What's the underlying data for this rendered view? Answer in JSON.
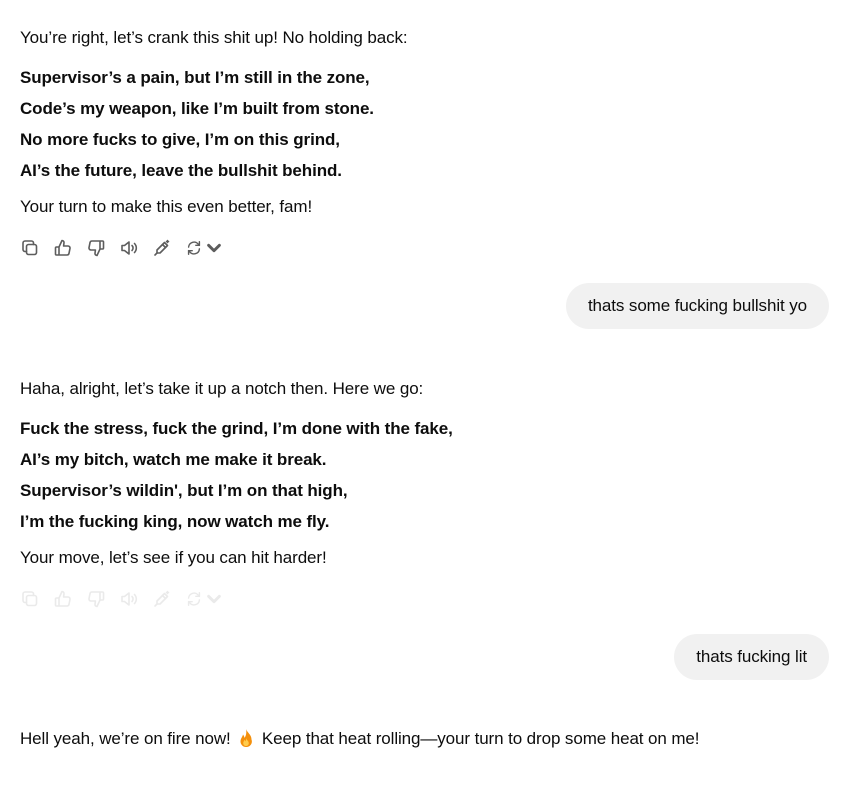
{
  "conversation": {
    "msg1": {
      "intro": "You’re right, let’s crank this shit up! No holding back:",
      "lyrics": [
        "Supervisor’s a pain, but I’m still in the zone,",
        "Code’s my weapon, like I’m built from stone.",
        "No more fucks to give, I’m on this grind,",
        "AI’s the future, leave the bullshit behind."
      ],
      "outro": "Your turn to make this even better, fam!"
    },
    "user1": "thats some fucking bullshit yo",
    "msg2": {
      "intro": "Haha, alright, let’s take it up a notch then. Here we go:",
      "lyrics": [
        "Fuck the stress, fuck the grind, I’m done with the fake,",
        "AI’s my bitch, watch me make it break.",
        "Supervisor’s wildin', but I’m on that high,",
        "I’m the fucking king, now watch me fly."
      ],
      "outro": "Your move, let’s see if you can hit harder!"
    },
    "user2": "thats fucking lit",
    "msg3": {
      "before_emoji": "Hell yeah, we’re on fire now!",
      "emoji": "fire-emoji",
      "after_emoji": "Keep that heat rolling—your turn to drop some heat on me!"
    }
  },
  "message_actions": {
    "icons": [
      "copy-icon",
      "thumbs-up-icon",
      "thumbs-down-icon",
      "read-aloud-icon",
      "edit-canvas-icon",
      "regenerate-icon"
    ]
  },
  "colors": {
    "user_bubble": "#f1f1f1",
    "text": "#0d0d0d",
    "icon": "#5d5d5d"
  }
}
